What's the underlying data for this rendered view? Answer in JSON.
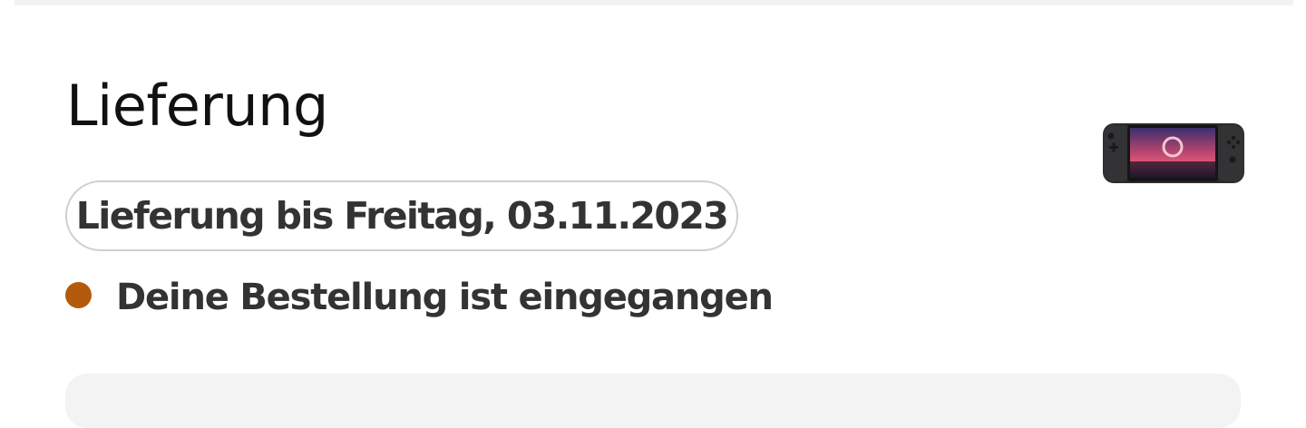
{
  "delivery": {
    "title": "Lieferung",
    "date_label": "Lieferung bis Freitag, 03.11.2023",
    "status": {
      "text": "Deine Bestellung ist eingegangen",
      "dot_color": "#b45a0c"
    },
    "product_image": "handheld-console-product-image"
  }
}
